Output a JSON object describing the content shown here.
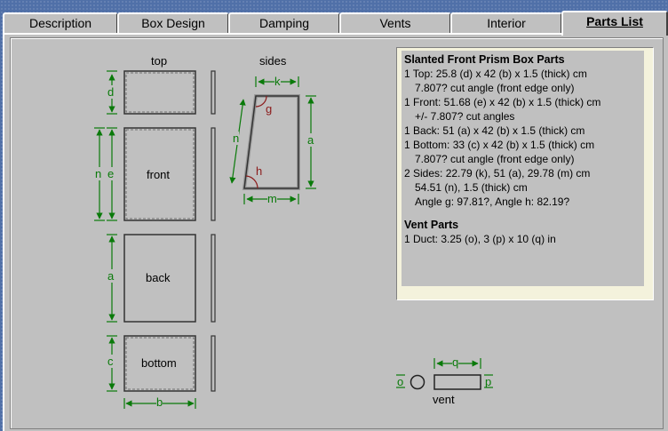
{
  "tabs": [
    {
      "label": "Description",
      "active": false
    },
    {
      "label": "Box Design",
      "active": false
    },
    {
      "label": "Damping",
      "active": false
    },
    {
      "label": "Vents",
      "active": false
    },
    {
      "label": "Interior",
      "active": false
    },
    {
      "label": "Parts List",
      "active": true
    }
  ],
  "diagram": {
    "top_label": "top",
    "sides_label": "sides",
    "front_label": "front",
    "back_label": "back",
    "bottom_label": "bottom",
    "vent_label": "vent",
    "dims": {
      "d": "d",
      "n": "n",
      "e": "e",
      "a": "a",
      "c": "c",
      "b": "b",
      "k": "k",
      "g": "g",
      "h": "h",
      "m": "m",
      "o": "o",
      "p": "p",
      "q": "q"
    }
  },
  "parts": {
    "title": "Slanted Front Prism Box Parts",
    "lines": [
      {
        "text": "1 Top:  25.8 (d) x 42 (b) x 1.5 (thick) cm",
        "indent": false
      },
      {
        "text": "7.807? cut angle (front edge only)",
        "indent": true
      },
      {
        "text": "1 Front:  51.68 (e) x 42 (b) x 1.5 (thick) cm",
        "indent": false
      },
      {
        "text": "+/- 7.807? cut angles",
        "indent": true
      },
      {
        "text": "1 Back:  51 (a) x 42 (b) x 1.5 (thick) cm",
        "indent": false
      },
      {
        "text": "1 Bottom:  33 (c) x 42 (b) x 1.5 (thick) cm",
        "indent": false
      },
      {
        "text": "7.807? cut angle (front edge only)",
        "indent": true
      },
      {
        "text": "2 Sides:  22.79 (k), 51 (a), 29.78 (m) cm",
        "indent": false
      },
      {
        "text": "54.51 (n), 1.5 (thick) cm",
        "indent": true
      },
      {
        "text": "Angle g: 97.81?, Angle h: 82.19?",
        "indent": true
      }
    ],
    "vent_title": "Vent Parts",
    "vent_lines": [
      {
        "text": "1 Duct:  3.25 (o), 3 (p) x 10 (q) in"
      }
    ]
  },
  "colors": {
    "dimension": "#0a7a0a",
    "angle": "#8b1a1a",
    "panel": "#c0c0c0"
  }
}
